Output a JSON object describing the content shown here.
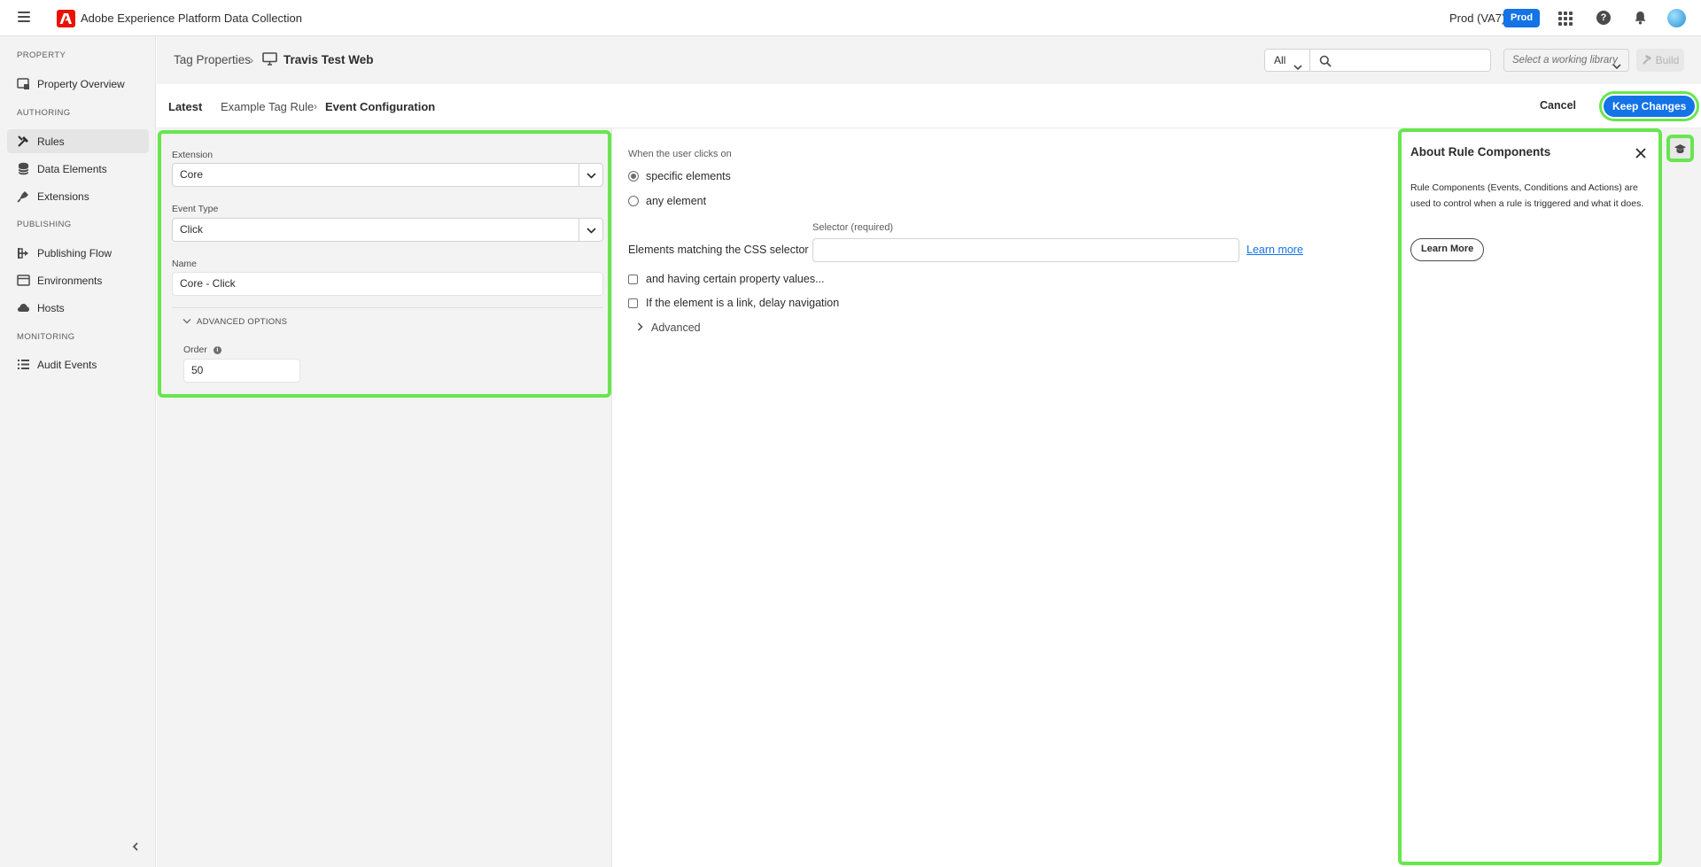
{
  "app": {
    "title": "Adobe Experience Platform Data Collection",
    "org": "Prod (VA7)",
    "env_badge": "Prod"
  },
  "sidebar": {
    "sections": {
      "property": "PROPERTY",
      "authoring": "AUTHORING",
      "publishing": "PUBLISHING",
      "monitoring": "MONITORING"
    },
    "items": [
      {
        "label": "Property Overview",
        "icon": "property-overview-icon"
      },
      {
        "label": "Rules",
        "icon": "rules-icon",
        "active": true
      },
      {
        "label": "Data Elements",
        "icon": "data-elements-icon"
      },
      {
        "label": "Extensions",
        "icon": "extensions-icon"
      },
      {
        "label": "Publishing Flow",
        "icon": "publishing-flow-icon"
      },
      {
        "label": "Environments",
        "icon": "environments-icon"
      },
      {
        "label": "Hosts",
        "icon": "cloud-icon"
      },
      {
        "label": "Audit Events",
        "icon": "list-icon"
      }
    ]
  },
  "header": {
    "breadcrumb_root": "Tag Properties",
    "property_name": "Travis Test Web",
    "filter_value": "All",
    "search_placeholder": "",
    "library_placeholder": "Select a working library",
    "build_label": "Build"
  },
  "subheader": {
    "latest": "Latest",
    "rule_name": "Example Tag Rule",
    "current": "Event Configuration",
    "cancel_label": "Cancel",
    "keep_label": "Keep Changes"
  },
  "config": {
    "extension_label": "Extension",
    "extension_value": "Core",
    "event_type_label": "Event Type",
    "event_type_value": "Click",
    "name_label": "Name",
    "name_value": "Core - Click",
    "advanced_label": "ADVANCED OPTIONS",
    "order_label": "Order",
    "order_value": "50"
  },
  "event": {
    "when_label": "When the user clicks on",
    "option_specific": "specific elements",
    "option_any": "any element",
    "selector_label": "Selector (required)",
    "css_label": "Elements matching the CSS selector",
    "selector_value": "",
    "learn_more_link": "Learn more",
    "property_values_label": "and having certain property values...",
    "delay_nav_label": "If the element is a link, delay navigation",
    "advanced_label": "Advanced"
  },
  "help": {
    "title": "About Rule Components",
    "body": "Rule Components (Events, Conditions and Actions) are used to control when a rule is triggered and what it does.",
    "learn_more_label": "Learn More"
  },
  "colors": {
    "accent": "#1473e6",
    "highlight": "#67e64d",
    "adobe_red": "#eb1000"
  }
}
